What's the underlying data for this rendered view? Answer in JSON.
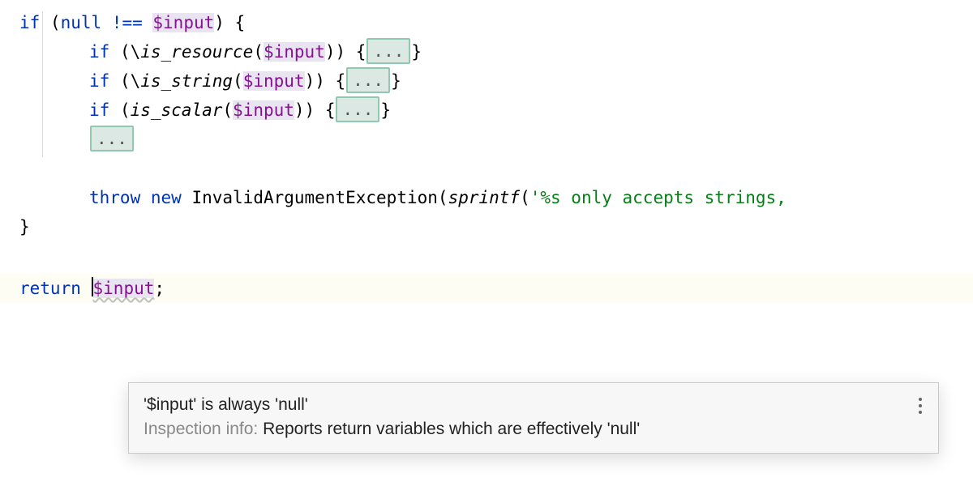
{
  "code": {
    "if": "if",
    "null_neq": "null !== ",
    "var_input": "$input",
    "open_brace": ") {",
    "close_brace": "}",
    "backslash": "\\",
    "fn_is_resource": "is_resource",
    "fn_is_string": "is_string",
    "fn_is_scalar": "is_scalar",
    "fold_ellipsis": "...",
    "throw": "throw",
    "new": "new",
    "exception": "InvalidArgumentException",
    "sprintf": "sprintf",
    "string_literal": "'%s only accepts strings,",
    "return": "return",
    "semicolon": ";",
    "open_paren": "(",
    "close_paren": ")",
    "space": " ",
    "double_close": ")) {",
    "if_open": "if ("
  },
  "popup": {
    "title_pre": "'$input' is always 'null'",
    "info_label": "Inspection info: ",
    "info_text": "Reports return variables which are effectively 'null'"
  }
}
